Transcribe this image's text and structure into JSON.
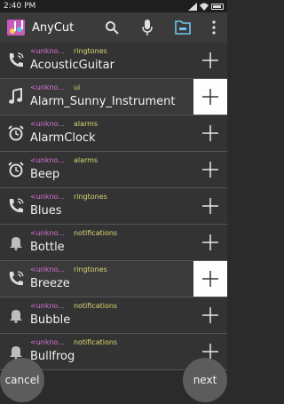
{
  "status_bar": {
    "time": "2:40 PM"
  },
  "app": {
    "title": "AnyCut"
  },
  "toolbar": {
    "icons": [
      "search-icon",
      "microphone-icon",
      "folder-icon",
      "overflow-menu-icon"
    ]
  },
  "items": [
    {
      "source": "<unkno...",
      "category": "ringtones",
      "title": "AcousticGuitar",
      "icon": "phone-ring-icon"
    },
    {
      "source": "<unkno...",
      "category": "ui",
      "title": "Alarm_Sunny_Instrument",
      "icon": "music-note-icon"
    },
    {
      "source": "<unkno...",
      "category": "alarms",
      "title": "AlarmClock",
      "icon": "alarm-clock-icon"
    },
    {
      "source": "<unkno...",
      "category": "alarms",
      "title": "Beep",
      "icon": "alarm-clock-icon"
    },
    {
      "source": "<unkno...",
      "category": "ringtones",
      "title": "Blues",
      "icon": "phone-ring-icon"
    },
    {
      "source": "<unkno...",
      "category": "notifications",
      "title": "Bottle",
      "icon": "bell-icon"
    },
    {
      "source": "<unkno...",
      "category": "ringtones",
      "title": "Breeze",
      "icon": "phone-ring-icon"
    },
    {
      "source": "<unkno...",
      "category": "notifications",
      "title": "Bubble",
      "icon": "bell-icon"
    },
    {
      "source": "<unkno...",
      "category": "notifications",
      "title": "Bullfrog",
      "icon": "bell-icon"
    }
  ],
  "buttons": {
    "cancel": "cancel",
    "next": "next"
  }
}
